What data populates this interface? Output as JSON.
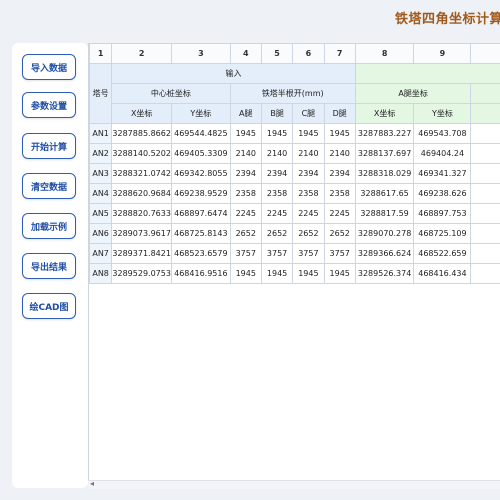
{
  "app": {
    "title": "铁塔四角坐标计算工"
  },
  "sidebar": {
    "buttons": [
      {
        "label": "导入数据"
      },
      {
        "label": "参数设置"
      },
      {
        "label": "开始计算"
      },
      {
        "label": "清空数据"
      },
      {
        "label": "加载示例"
      },
      {
        "label": "导出结果"
      },
      {
        "label": "绘CAD图"
      }
    ]
  },
  "table": {
    "col_numbers": [
      "1",
      "2",
      "3",
      "4",
      "5",
      "6",
      "7",
      "8",
      "9"
    ],
    "input_header": "输入",
    "row_label_header": "塔号",
    "group_center": "中心桩坐标",
    "group_half": "铁塔半根开(mm)",
    "group_a": "A腿坐标",
    "sub_x": "X坐标",
    "sub_y": "Y坐标",
    "sub_a": "A腿",
    "sub_b": "B腿",
    "sub_c": "C腿",
    "sub_d": "D腿",
    "sub_ax": "X坐标",
    "sub_ay": "Y坐标",
    "rows": [
      {
        "id": "AN1",
        "x": "3287885.8662",
        "y": "469544.4825",
        "a": "1945",
        "b": "1945",
        "c": "1945",
        "d": "1945",
        "ax": "3287883.227",
        "ay": "469543.708"
      },
      {
        "id": "AN2",
        "x": "3288140.5202",
        "y": "469405.3309",
        "a": "2140",
        "b": "2140",
        "c": "2140",
        "d": "2140",
        "ax": "3288137.697",
        "ay": "469404.24"
      },
      {
        "id": "AN3",
        "x": "3288321.0742",
        "y": "469342.8055",
        "a": "2394",
        "b": "2394",
        "c": "2394",
        "d": "2394",
        "ax": "3288318.029",
        "ay": "469341.327"
      },
      {
        "id": "AN4",
        "x": "3288620.9684",
        "y": "469238.9529",
        "a": "2358",
        "b": "2358",
        "c": "2358",
        "d": "2358",
        "ax": "3288617.65",
        "ay": "469238.626"
      },
      {
        "id": "AN5",
        "x": "3288820.7633",
        "y": "468897.6474",
        "a": "2245",
        "b": "2245",
        "c": "2245",
        "d": "2245",
        "ax": "3288817.59",
        "ay": "468897.753"
      },
      {
        "id": "AN6",
        "x": "3289073.9617",
        "y": "468725.8143",
        "a": "2652",
        "b": "2652",
        "c": "2652",
        "d": "2652",
        "ax": "3289070.278",
        "ay": "468725.109"
      },
      {
        "id": "AN7",
        "x": "3289371.8421",
        "y": "468523.6579",
        "a": "3757",
        "b": "3757",
        "c": "3757",
        "d": "3757",
        "ax": "3289366.624",
        "ay": "468522.659"
      },
      {
        "id": "AN8",
        "x": "3289529.0753",
        "y": "468416.9516",
        "a": "1945",
        "b": "1945",
        "c": "1945",
        "d": "1945",
        "ax": "3289526.374",
        "ay": "468416.434"
      }
    ]
  },
  "scrollbar": {
    "left_arrow": "◂"
  }
}
